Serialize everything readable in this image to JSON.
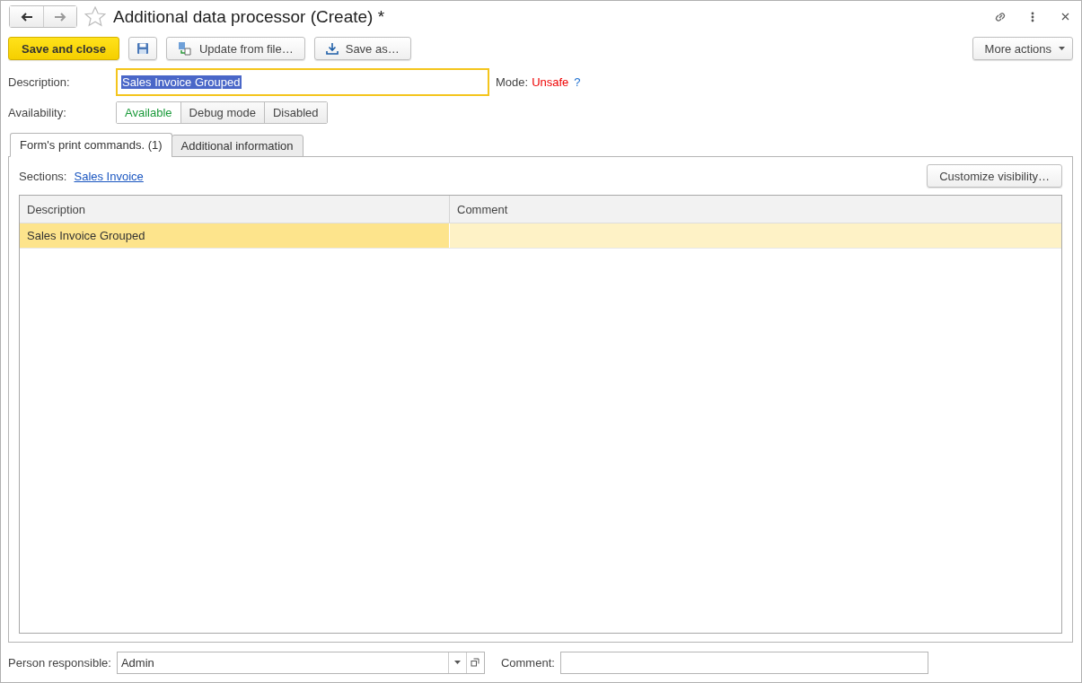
{
  "window": {
    "title": "Additional data processor (Create) *"
  },
  "toolbar": {
    "buttons": [
      {
        "kind": "primary",
        "label": "Save and close"
      },
      {
        "kind": "save-icon"
      },
      {
        "kind": "update",
        "label": "Update from file…"
      },
      {
        "kind": "download",
        "label": "Save as…"
      }
    ],
    "more_actions": "More actions"
  },
  "description": {
    "label": "Description:",
    "value": "Sales Invoice Grouped",
    "selected": true
  },
  "mode": {
    "label": "Mode:",
    "value": "Unsafe",
    "help": "?"
  },
  "availability": {
    "label": "Availability:",
    "options": [
      {
        "label": "Available",
        "selected": true
      },
      {
        "label": "Debug mode",
        "selected": false
      },
      {
        "label": "Disabled",
        "selected": false
      }
    ]
  },
  "tabs": [
    {
      "label": "Form's print commands. (1)",
      "selected": true
    },
    {
      "label": "Additional information",
      "selected": false
    }
  ],
  "sections": {
    "label": "Sections:",
    "link": "Sales Invoice"
  },
  "customize_button": "Customize visibility…",
  "table": {
    "columns": [
      "Description",
      "Comment"
    ],
    "rows": [
      {
        "cells": [
          "Sales Invoice Grouped",
          ""
        ],
        "selected": true
      }
    ]
  },
  "footer": {
    "person_responsible": {
      "label": "Person responsible:",
      "value": "Admin"
    },
    "comment": {
      "label": "Comment:"
    }
  }
}
